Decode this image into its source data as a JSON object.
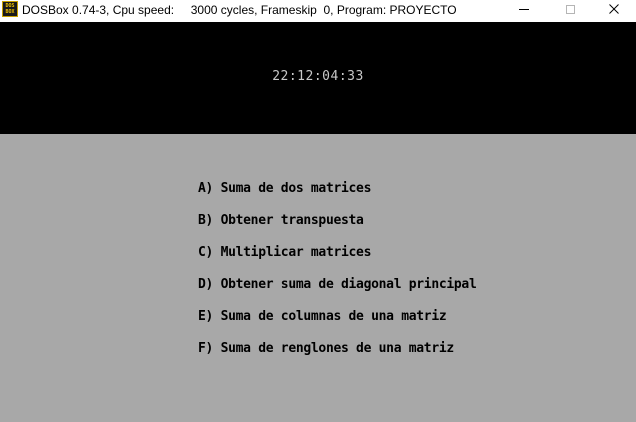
{
  "window": {
    "icon_text_top": "DOS",
    "icon_text_bottom": "BOX",
    "title": "DOSBox 0.74-3, Cpu speed:     3000 cycles, Frameskip  0, Program: PROYECTO",
    "controls": [
      "minimize-icon",
      "maximize-icon",
      "close-icon"
    ]
  },
  "screen": {
    "clock": "22:12:04:33",
    "colors": {
      "top_band": "#000000",
      "bottom_band": "#a8a8a8",
      "clock_text": "#c8c8c8",
      "menu_text": "#000000"
    },
    "menu": [
      "A) Suma de dos matrices",
      "B) Obtener transpuesta",
      "C) Multiplicar matrices",
      "D) Obtener suma de diagonal principal",
      "E) Suma de columnas de una matriz",
      "F) Suma de renglones de una matriz"
    ]
  }
}
